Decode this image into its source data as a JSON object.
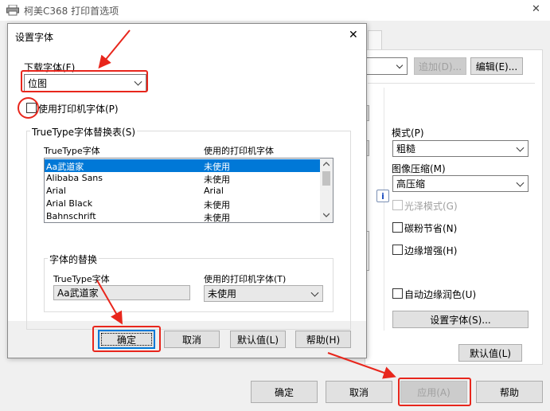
{
  "bg_window": {
    "title": "柯美C368 打印首选项",
    "close_glyph": "✕",
    "add_label": "追加(D)...",
    "edit_label": "编辑(E)...",
    "mode_label": "模式(P)",
    "mode_value": "粗糙",
    "image_compress_label": "图像压缩(M)",
    "image_compress_value": "高压缩",
    "gloss_label": "光泽模式(G)",
    "toner_save_label": "碳粉节省(N)",
    "edge_enhance_label": "边缘增强(H)",
    "auto_edge_label": "自动边缘润色(U)",
    "font_settings_label": "设置字体(S)...",
    "defaults_label": "默认值(L)",
    "ok_label": "确定",
    "cancel_label": "取消",
    "apply_label": "应用(A)",
    "help_label": "帮助",
    "info_glyph": "i"
  },
  "dialog": {
    "title": "设置字体",
    "close_glyph": "✕",
    "download_font_label": "下载字体(F)",
    "download_font_value": "位图",
    "use_printer_font_label": "使用打印机字体(P)",
    "truetype_table_label": "TrueType字体替换表(S)",
    "col_truetype": "TrueType字体",
    "col_printer": "使用的打印机字体",
    "rows": [
      {
        "font": "Aa武道家",
        "printer": "未使用"
      },
      {
        "font": "Alibaba Sans",
        "printer": "未使用"
      },
      {
        "font": "Arial",
        "printer": "Arial"
      },
      {
        "font": "Arial Black",
        "printer": "未使用"
      },
      {
        "font": "Bahnschrift",
        "printer": "未使用"
      }
    ],
    "substitution_label": "字体的替换",
    "sub_truetype_label": "TrueType字体",
    "sub_truetype_value": "Aa武道家",
    "sub_printer_label": "使用的打印机字体(T)",
    "sub_printer_value": "未使用",
    "ok_label": "确定",
    "cancel_label": "取消",
    "defaults_label": "默认值(L)",
    "help_label": "帮助(H)"
  },
  "colors": {
    "annotation_red": "#e8261c",
    "selection_blue": "#0078d7"
  }
}
